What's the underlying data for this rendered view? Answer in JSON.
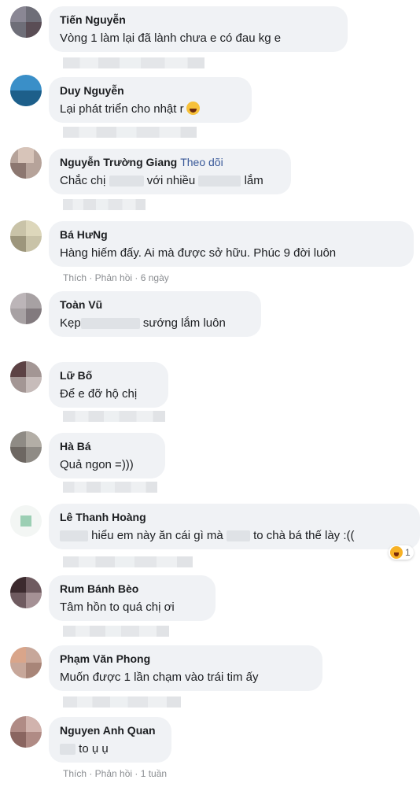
{
  "comments": [
    {
      "author": "Tiến Nguyễn",
      "text": "Vòng 1 làm lại đã lành chưa e có đau kg e"
    },
    {
      "author": "Duy Nguyễn",
      "text": "Lại phát triển cho nhật r",
      "emoji": "laughing-emoji"
    },
    {
      "author": "Nguyễn Trường Giang",
      "follow": "Theo dõi",
      "text_a": "Chắc chị",
      "text_b": "với nhiều",
      "text_c": "lắm"
    },
    {
      "author": "Bá HưNg",
      "text": "Hàng hiếm đấy. Ai mà được sở hữu. Phúc 9 đời luôn",
      "actions": "Thích · Phản hồi · 6 ngày"
    },
    {
      "author": "Toàn Vũ",
      "text_a": "Kẹp",
      "text_b": "sướng lắm luôn"
    },
    {
      "author": "Lữ Bố",
      "text": "Để e đỡ hộ chị"
    },
    {
      "author": "Hà Bá",
      "text": "Quả ngon =)))"
    },
    {
      "author": "Lê Thanh Hoàng",
      "text_a": "hiểu em này ăn cái gì mà",
      "text_b": "to chà bá thế lày :((",
      "reaction_count": "1"
    },
    {
      "author": "Rum Bánh Bèo",
      "text": "Tâm hồn to quá chị ơi"
    },
    {
      "author": "Phạm Văn Phong",
      "text": "Muốn được 1 lần chạm vào trái tim ấy"
    },
    {
      "author": "Nguyen Anh Quan",
      "text": "to ụ ụ",
      "actions": "Thích · Phản hồi · 1 tuần"
    }
  ]
}
